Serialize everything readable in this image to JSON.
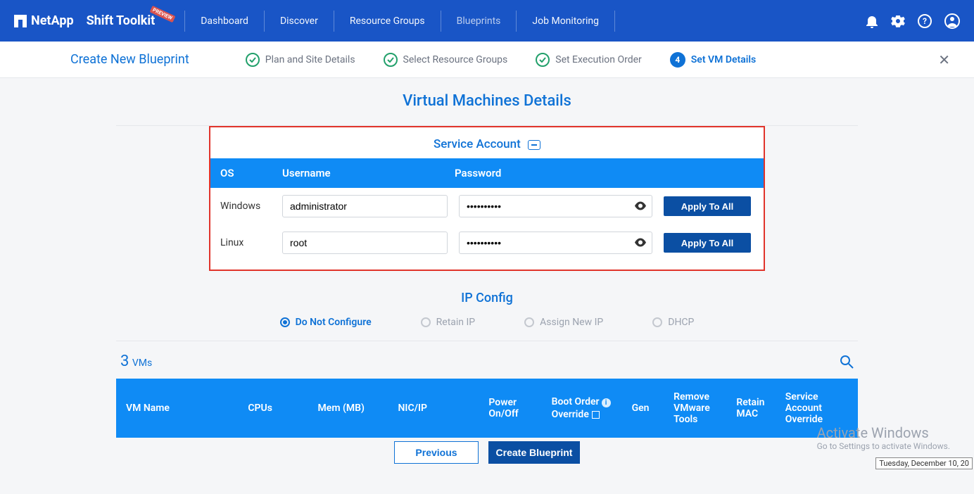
{
  "brand": "NetApp",
  "toolkit": "Shift Toolkit",
  "preview_tag": "PREVIEW",
  "nav": {
    "dashboard": "Dashboard",
    "discover": "Discover",
    "resource_groups": "Resource Groups",
    "blueprints": "Blueprints",
    "job_monitoring": "Job Monitoring"
  },
  "subheader": {
    "title": "Create New Blueprint",
    "steps": {
      "plan": "Plan and Site Details",
      "select": "Select Resource Groups",
      "exec": "Set Execution Order",
      "vm": "Set VM Details",
      "vm_num": "4"
    }
  },
  "page_title": "Virtual Machines Details",
  "service": {
    "title": "Service Account",
    "head_os": "OS",
    "head_user": "Username",
    "head_pass": "Password",
    "rows": [
      {
        "os": "Windows",
        "user": "administrator",
        "pass": "••••••••••",
        "btn": "Apply To All"
      },
      {
        "os": "Linux",
        "user": "root",
        "pass": "••••••••••",
        "btn": "Apply To All"
      }
    ]
  },
  "ipconfig": {
    "title": "IP Config",
    "opts": {
      "noconfig": "Do Not Configure",
      "retain": "Retain IP",
      "assign": "Assign New IP",
      "dhcp": "DHCP"
    }
  },
  "vms": {
    "count_num": "3",
    "count_label": "VMs"
  },
  "table_head": {
    "vmname": "VM Name",
    "cpus": "CPUs",
    "mem": "Mem (MB)",
    "nic": "NIC/IP",
    "power": "Power On/Off",
    "boot_l1": "Boot Order",
    "boot_l2": "Override",
    "gen": "Gen",
    "remove": "Remove VMware Tools",
    "retain": "Retain MAC",
    "override": "Service Account Override"
  },
  "footer": {
    "previous": "Previous",
    "create": "Create Blueprint"
  },
  "activate": {
    "l1": "Activate Windows",
    "l2": "Go to Settings to activate Windows."
  },
  "datebar": "Tuesday, December 10, 20"
}
